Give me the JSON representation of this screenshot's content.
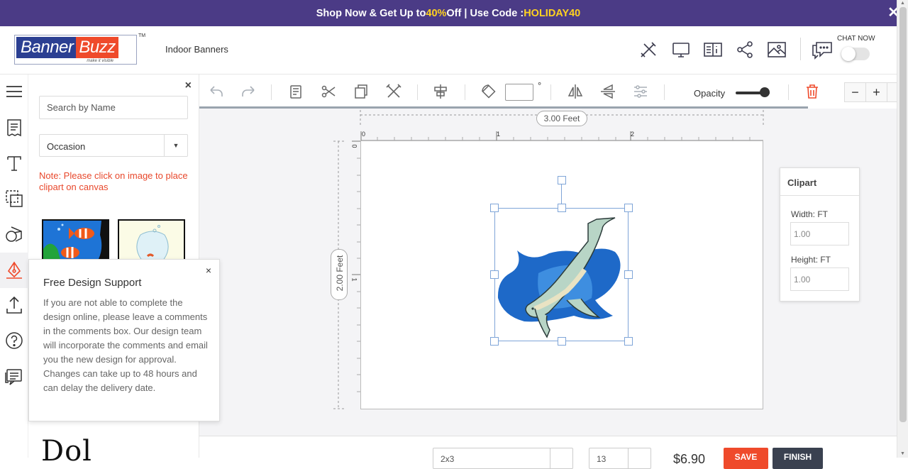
{
  "promo": {
    "text_before": "Shop Now & Get Up to ",
    "discount": "40%",
    "text_middle": " Off | Use Code : ",
    "code": "HOLIDAY40",
    "close_glyph": "✕"
  },
  "header": {
    "logo_banner": "Banner",
    "logo_buzz": "Buzz",
    "logo_tagline": "make it visible",
    "trademark": "TM",
    "page_title": "Indoor Banners",
    "icons": [
      "tools-icon",
      "desktop-preview-icon",
      "book-info-icon",
      "share-icon",
      "image-icon",
      "chat-icon"
    ],
    "chat_label": "CHAT NOW"
  },
  "left_panel": {
    "close_glyph": "×",
    "search_placeholder": "Search by Name",
    "occasion_value": "Occasion",
    "note": "Note: Please click on image to place clipart on canvas",
    "bottom_text": "Dol"
  },
  "tooltip": {
    "title": "Free Design Support",
    "close_glyph": "×",
    "body": "If you are not able to complete the design online, please leave a comments in the comments box. Our design team will incorporate the comments and email you the new design for approval. Changes can take up to 48 hours and can delay the delivery date."
  },
  "toolbar": {
    "rotation_value": "",
    "degree_symbol": "°",
    "opacity_label": "Opacity",
    "opacity_value": 1.0,
    "zoom_out": "−",
    "zoom_in": "+"
  },
  "canvas": {
    "width_label": "3.00 Feet",
    "height_label": "2.00 Feet",
    "ruler_top": [
      "0",
      "1",
      "2"
    ],
    "ruler_left": [
      "0",
      "1"
    ]
  },
  "clipart_props": {
    "title": "Clipart",
    "width_label": "Width: FT",
    "width_value": "1.00",
    "height_label": "Height: FT",
    "height_value": "1.00"
  },
  "bottom_bar": {
    "select1": "2x3",
    "select2": "13",
    "price": "$6.90",
    "save": "SAVE",
    "finish": "FINISH"
  },
  "colors": {
    "promo_bg": "#4b3b86",
    "promo_highlight": "#ffd21f",
    "brand_blue": "#2b3f92",
    "brand_orange": "#ef4a2b",
    "note_red": "#e8482c",
    "selection_blue": "#7fa5d8"
  }
}
